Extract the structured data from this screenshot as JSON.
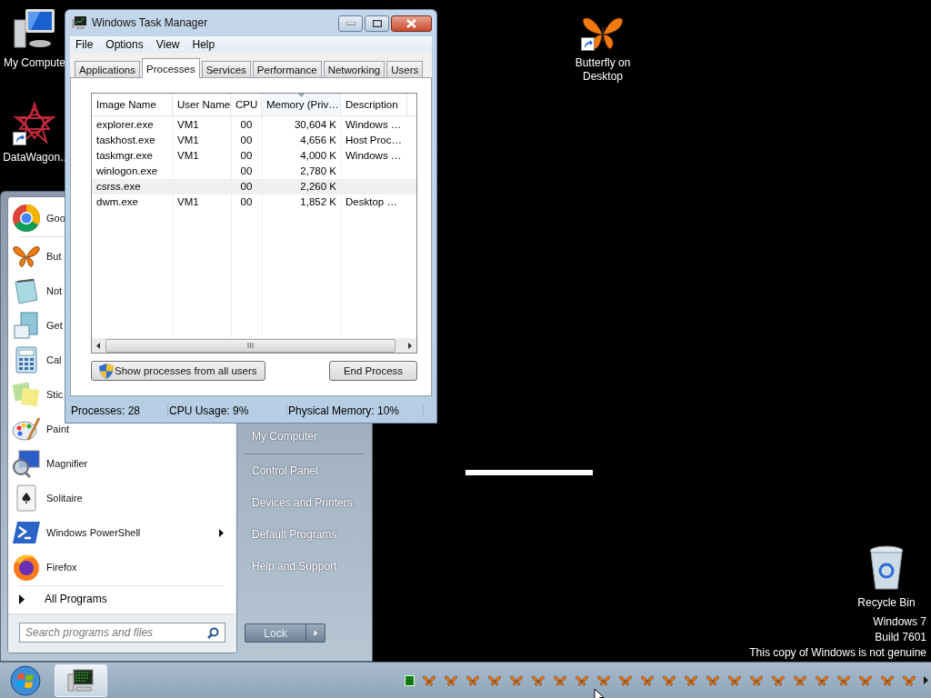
{
  "desktop_icons": [
    {
      "label": "My Compute",
      "shortcut": false
    },
    {
      "label": "DataWagon..",
      "shortcut": true
    },
    {
      "label": "Butterfly on Desktop",
      "shortcut": true
    },
    {
      "label": "Recycle Bin",
      "shortcut": false
    }
  ],
  "desktop_notice": [
    "Windows 7",
    "Build 7601",
    "This copy of Windows is not genuine"
  ],
  "task_manager": {
    "title": "Windows Task Manager",
    "menu": [
      "File",
      "Options",
      "View",
      "Help"
    ],
    "tabs": [
      {
        "label": "Applications",
        "selected": false
      },
      {
        "label": "Processes",
        "selected": true
      },
      {
        "label": "Services",
        "selected": false
      },
      {
        "label": "Performance",
        "selected": false
      },
      {
        "label": "Networking",
        "selected": false
      },
      {
        "label": "Users",
        "selected": false
      }
    ],
    "columns": [
      {
        "label": "Image Name",
        "sorted": false
      },
      {
        "label": "User Name",
        "sorted": false
      },
      {
        "label": "CPU",
        "sorted": false
      },
      {
        "label": "Memory (Priv…",
        "sorted": true
      },
      {
        "label": "Description",
        "sorted": false
      }
    ],
    "rows": [
      {
        "cells": [
          "explorer.exe",
          "VM1",
          "00",
          "30,604 K",
          "Windows …"
        ],
        "selected": false
      },
      {
        "cells": [
          "taskhost.exe",
          "VM1",
          "00",
          "4,656 K",
          "Host Proc…"
        ],
        "selected": false
      },
      {
        "cells": [
          "taskmgr.exe",
          "VM1",
          "00",
          "4,000 K",
          "Windows …"
        ],
        "selected": false
      },
      {
        "cells": [
          "winlogon.exe",
          "",
          "00",
          "2,780 K",
          ""
        ],
        "selected": false
      },
      {
        "cells": [
          "csrss.exe",
          "",
          "00",
          "2,260 K",
          ""
        ],
        "selected": true
      },
      {
        "cells": [
          "dwm.exe",
          "VM1",
          "00",
          "1,852 K",
          "Desktop …"
        ],
        "selected": false
      }
    ],
    "buttons": [
      "Show processes from all users",
      "End Process"
    ],
    "status_bar": [
      "Processes: 28",
      "CPU Usage: 9%",
      "Physical Memory: 10%"
    ]
  },
  "start_menu": {
    "programs": [
      {
        "label": "Goo",
        "submenu": false
      },
      {
        "label": "But",
        "submenu": false
      },
      {
        "label": "Not",
        "submenu": false
      },
      {
        "label": "Get",
        "submenu": false
      },
      {
        "label": "Cal",
        "submenu": false
      },
      {
        "label": "Stic",
        "submenu": false
      },
      {
        "label": "Paint",
        "submenu": false
      },
      {
        "label": "Magnifier",
        "submenu": false
      },
      {
        "label": "Solitaire",
        "submenu": false
      },
      {
        "label": "Windows PowerShell",
        "submenu": true
      },
      {
        "label": "Firefox",
        "submenu": false
      }
    ],
    "all_programs": "All Programs",
    "search": {
      "placeholder": "Search programs and files"
    },
    "places": [
      "My Computer",
      "Control Panel",
      "Devices and Printers",
      "Default Programs",
      "Help and Support"
    ],
    "lock_button": "Lock"
  },
  "taskbar": {
    "buttons": [
      {
        "kind": "task-manager",
        "active": true
      }
    ]
  }
}
